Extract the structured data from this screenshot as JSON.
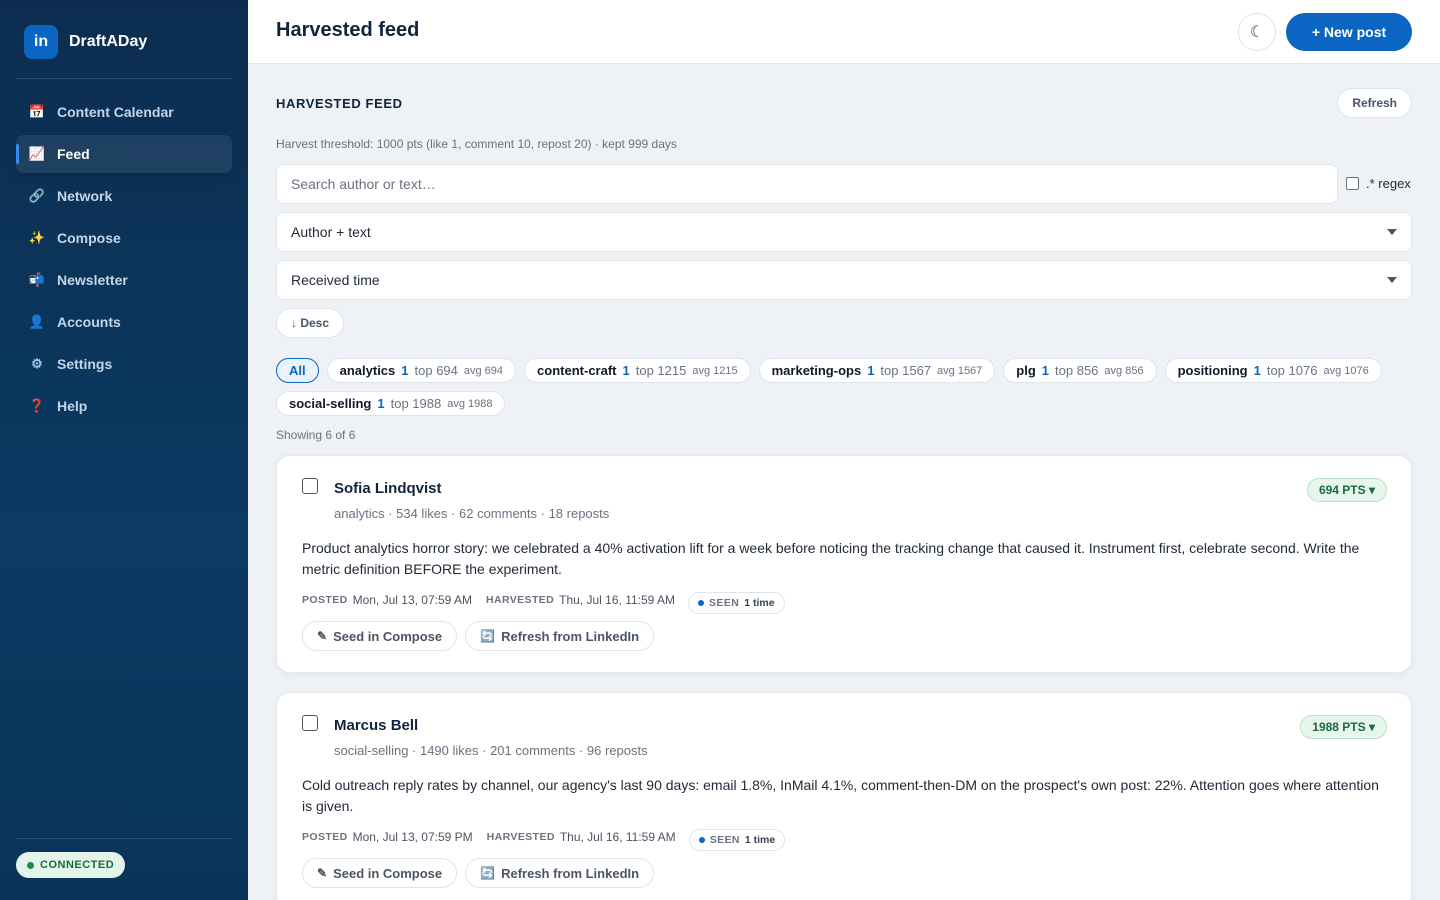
{
  "app": {
    "name": "DraftADay",
    "logo": "in",
    "brand_color": "#0a66c2"
  },
  "sidebar": {
    "items": [
      {
        "label": "Content Calendar",
        "icon": "📅",
        "icon_name": "calendar-icon"
      },
      {
        "label": "Feed",
        "icon": "📈",
        "icon_name": "chart-icon",
        "active": true
      },
      {
        "label": "Network",
        "icon": "🔗",
        "icon_name": "link-icon"
      },
      {
        "label": "Compose",
        "icon": "✨",
        "icon_name": "sparkles-icon"
      },
      {
        "label": "Newsletter",
        "icon": "📬",
        "icon_name": "mailbox-icon"
      },
      {
        "label": "Accounts",
        "icon": "👤",
        "icon_name": "user-icon"
      },
      {
        "label": "Settings",
        "icon": "⚙",
        "icon_name": "gear-icon"
      },
      {
        "label": "Help",
        "icon": "❓",
        "icon_name": "question-icon"
      }
    ],
    "status": "CONNECTED"
  },
  "header": {
    "title": "Harvested feed",
    "theme_icon": "☾",
    "new_post_label": "+ New post"
  },
  "feed": {
    "section_title": "HARVESTED FEED",
    "refresh_label": "Refresh",
    "threshold_text": "Harvest threshold: 1000 pts (like 1, comment 10, repost 20) · kept 999 days",
    "search_placeholder": "Search author or text…",
    "regex_label": ".* regex",
    "scope_value": "Author + text",
    "sort_value": "Received time",
    "order_label": "↓ Desc",
    "all_label": "All",
    "topics": [
      {
        "name": "analytics",
        "count": "1",
        "top": "top 694",
        "avg": "avg 694"
      },
      {
        "name": "content-craft",
        "count": "1",
        "top": "top 1215",
        "avg": "avg 1215"
      },
      {
        "name": "marketing-ops",
        "count": "1",
        "top": "top 1567",
        "avg": "avg 1567"
      },
      {
        "name": "plg",
        "count": "1",
        "top": "top 856",
        "avg": "avg 856"
      },
      {
        "name": "positioning",
        "count": "1",
        "top": "top 1076",
        "avg": "avg 1076"
      },
      {
        "name": "social-selling",
        "count": "1",
        "top": "top 1988",
        "avg": "avg 1988"
      }
    ],
    "showing": "Showing 6 of 6",
    "posts": [
      {
        "author": "Sofia Lindqvist",
        "meta": "analytics · 534 likes · 62 comments · 18 reposts",
        "points": "694 PTS ▾",
        "text": "Product analytics horror story: we celebrated a 40% activation lift for a week before noticing the tracking change that caused it. Instrument first, celebrate second. Write the metric definition BEFORE the experiment.",
        "posted_label": "POSTED",
        "posted": "Mon, Jul 13, 07:59 AM",
        "harvested_label": "HARVESTED",
        "harvested": "Thu, Jul 16, 11:59 AM",
        "seen_label": "SEEN",
        "seen_value": "1 time",
        "seed_label": "Seed in Compose",
        "seed_icon": "✎",
        "refresh_label": "Refresh from LinkedIn",
        "refresh_icon": "🔄"
      },
      {
        "author": "Marcus Bell",
        "meta": "social-selling · 1490 likes · 201 comments · 96 reposts",
        "points": "1988 PTS ▾",
        "text": "Cold outreach reply rates by channel, our agency's last 90 days: email 1.8%, InMail 4.1%, comment-then-DM on the prospect's own post: 22%. Attention goes where attention is given.",
        "posted_label": "POSTED",
        "posted": "Mon, Jul 13, 07:59 PM",
        "harvested_label": "HARVESTED",
        "harvested": "Thu, Jul 16, 11:59 AM",
        "seen_label": "SEEN",
        "seen_value": "1 time",
        "seed_label": "Seed in Compose",
        "seed_icon": "✎",
        "refresh_label": "Refresh from LinkedIn",
        "refresh_icon": "🔄"
      }
    ]
  }
}
